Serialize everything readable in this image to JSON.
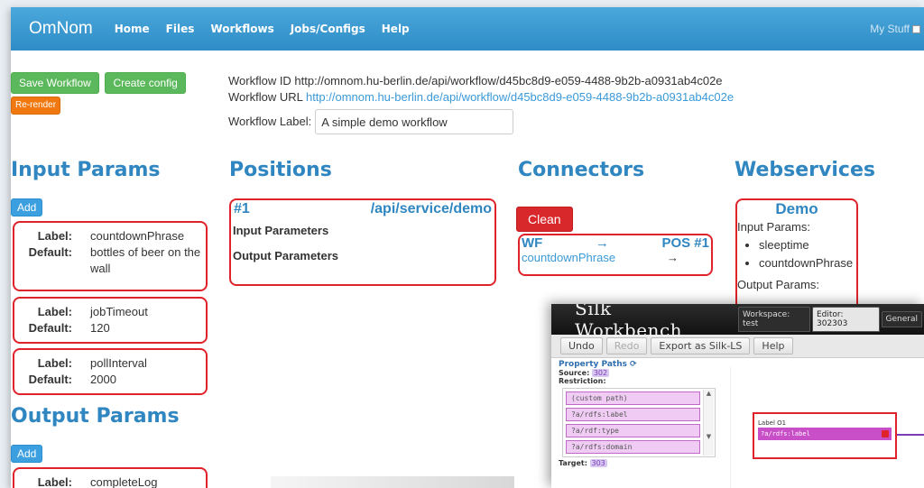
{
  "navbar": {
    "brand": "OmNom",
    "links": [
      "Home",
      "Files",
      "Workflows",
      "Jobs/Configs",
      "Help"
    ],
    "mystuff_label": "My Stuff"
  },
  "actions": {
    "save_workflow": "Save Workflow",
    "create_config": "Create config",
    "rerender": "Re-render"
  },
  "workflow": {
    "id_line": "Workflow ID http://omnom.hu-berlin.de/api/workflow/d45bc8d9-e059-4488-9b2b-a0931ab4c02e",
    "url_prefix": "Workflow URL ",
    "url": "http://omnom.hu-berlin.de/api/workflow/d45bc8d9-e059-4488-9b2b-a0931ab4c02e",
    "label_caption": "Workflow Label:",
    "label_value": "A simple demo workflow"
  },
  "input_params": {
    "title": "Input Params",
    "add_label": "Add",
    "label_key": "Label:",
    "default_key": "Default:",
    "items": [
      {
        "label": "countdownPhrase",
        "default": "bottles of beer on the wall"
      },
      {
        "label": "jobTimeout",
        "default": "120"
      },
      {
        "label": "pollInterval",
        "default": "2000"
      }
    ]
  },
  "output_params": {
    "title": "Output Params",
    "add_label": "Add",
    "label_key": "Label:",
    "items": [
      {
        "label": "completeLog"
      }
    ]
  },
  "positions": {
    "title": "Positions",
    "item": {
      "number": "#1",
      "service": "/api/service/demo",
      "input_header": "Input Parameters",
      "output_header": "Output Parameters"
    }
  },
  "connectors": {
    "title": "Connectors",
    "clean_label": "Clean",
    "head_from": "WF",
    "head_arrow": "→",
    "head_to": "POS #1",
    "row_param": "countdownPhrase",
    "row_arrow": "→"
  },
  "webservices": {
    "title": "Webservices",
    "item": {
      "name": "Demo",
      "input_caption": "Input Params:",
      "inputs": [
        "sleeptime",
        "countdownPhrase"
      ],
      "output_caption": "Output Params:"
    }
  },
  "silk": {
    "title": "Silk Workbench",
    "tabs": [
      "Workspace: test",
      "Editor: 302303",
      "General"
    ],
    "toolbar": [
      "Undo",
      "Redo",
      "Export as Silk-LS",
      "Help"
    ],
    "property_paths": "Property Paths",
    "source_label": "Source:",
    "source_value": "302",
    "restriction_label": "Restriction:",
    "paths": [
      "(custom path)",
      "?a/rdfs:label",
      "?a/rdf:type",
      "?a/rdfs:domain"
    ],
    "target_label": "Target:",
    "target_value": "303",
    "operator_title": "Label O1",
    "operator_path": "?a/rdfs:label"
  }
}
